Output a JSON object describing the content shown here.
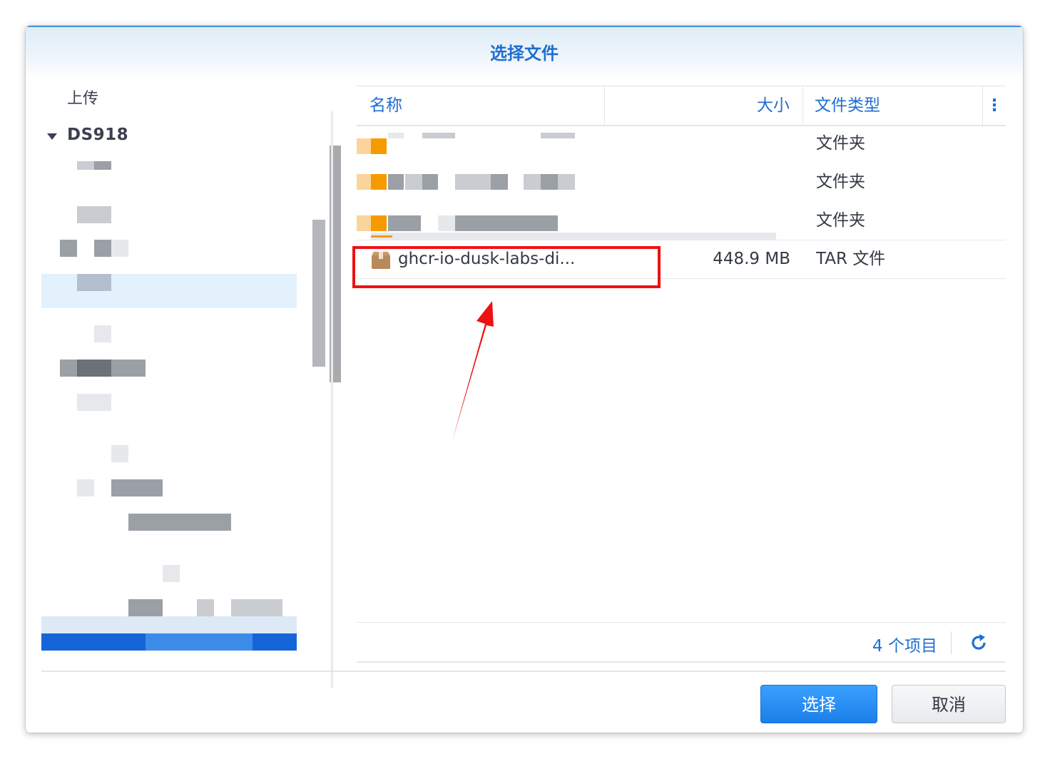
{
  "dialog": {
    "title": "选择文件"
  },
  "tree": {
    "upload_label": "上传",
    "root_label": "DS918"
  },
  "table": {
    "columns": {
      "name": "名称",
      "size": "大小",
      "type": "文件类型",
      "more": "⋮"
    },
    "rows": [
      {
        "name": "",
        "size": "",
        "type": "文件夹"
      },
      {
        "name": "",
        "size": "",
        "type": "文件夹"
      },
      {
        "name": "",
        "size": "",
        "type": "文件夹"
      },
      {
        "name": "ghcr-io-dusk-labs-di...",
        "size": "448.9 MB",
        "type": "TAR 文件"
      }
    ],
    "item_count": "4 个项目"
  },
  "buttons": {
    "select": "选择",
    "cancel": "取消"
  },
  "colors": {
    "accent": "#1f6fd0",
    "primary_button": "#1b7fe8",
    "highlight": "#ee1111",
    "folder": "#f59b00"
  },
  "icons": {
    "tar": "package-icon",
    "refresh": "refresh-icon",
    "expand": "caret-down-icon"
  }
}
